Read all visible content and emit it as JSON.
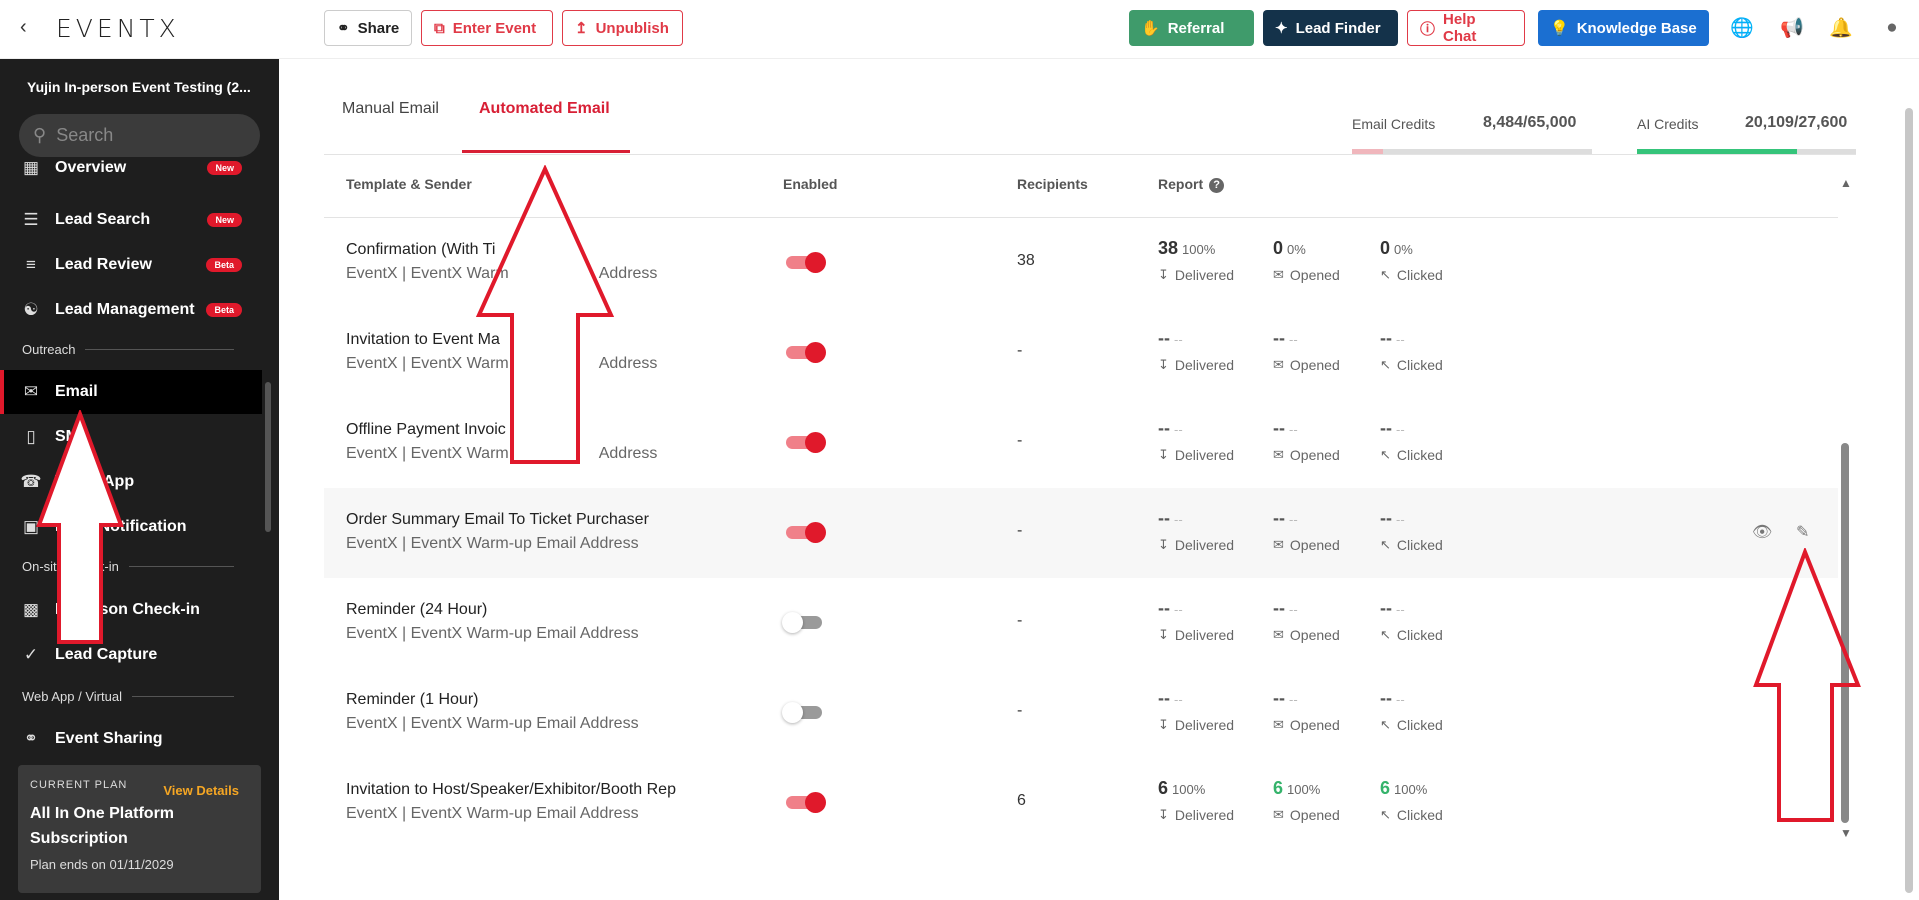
{
  "topbar": {
    "logo": "EVENTX",
    "share_label": "Share",
    "enter_label": "Enter Event",
    "unpublish_label": "Unpublish",
    "referral_label": "Referral",
    "lead_finder_label": "Lead Finder",
    "help_chat_label": "Help Chat",
    "knowledge_base_label": "Knowledge Base"
  },
  "sidebar": {
    "event_name": "Yujin In-person Event Testing (2...",
    "search_placeholder": "Search",
    "items": [
      {
        "label": "Overview",
        "badge": "New"
      },
      {
        "label": "Lead Search",
        "badge": "New"
      },
      {
        "label": "Lead Review",
        "badge": "Beta"
      },
      {
        "label": "Lead Management",
        "badge": "Beta"
      },
      {
        "label": "Email"
      },
      {
        "label": "SMS"
      },
      {
        "label": "WhatsApp"
      },
      {
        "label": "Push Notification"
      },
      {
        "label": "In-person Check-in"
      },
      {
        "label": "Lead Capture"
      },
      {
        "label": "Event Sharing"
      }
    ],
    "sections": [
      "Outreach",
      "On-site Check-in",
      "Web App / Virtual"
    ],
    "plan": {
      "current_label": "CURRENT PLAN",
      "view_details": "View Details",
      "name": "All In One Platform Subscription",
      "ends": "Plan ends on 01/11/2029"
    }
  },
  "main": {
    "tabs": [
      "Manual Email",
      "Automated Email"
    ],
    "email_credits_label": "Email Credits",
    "email_credits_value": "8,484/65,000",
    "email_credits_fill": 0.13,
    "ai_credits_label": "AI Credits",
    "ai_credits_value": "20,109/27,600",
    "ai_credits_fill": 0.73,
    "columns": [
      "Template & Sender",
      "Enabled",
      "Recipients",
      "Report"
    ],
    "stat_labels": [
      "Delivered",
      "Opened",
      "Clicked"
    ],
    "rows": [
      {
        "name": "Confirmation (With Ti",
        "sender": "EventX | EventX Warm",
        "sender_tail": "Address",
        "enabled": true,
        "recipients": "38",
        "stats": [
          {
            "v": "38",
            "p": "100%"
          },
          {
            "v": "0",
            "p": "0%"
          },
          {
            "v": "0",
            "p": "0%"
          }
        ]
      },
      {
        "name": "Invitation to Event Ma",
        "sender": "EventX | EventX Warm",
        "sender_tail": "Address",
        "enabled": true,
        "recipients": "-",
        "stats": [
          {
            "v": "--",
            "p": "--"
          },
          {
            "v": "--",
            "p": "--"
          },
          {
            "v": "--",
            "p": "--"
          }
        ]
      },
      {
        "name": "Offline Payment Invoic",
        "sender": "EventX | EventX Warm",
        "sender_tail": "Address",
        "enabled": true,
        "recipients": "-",
        "stats": [
          {
            "v": "--",
            "p": "--"
          },
          {
            "v": "--",
            "p": "--"
          },
          {
            "v": "--",
            "p": "--"
          }
        ]
      },
      {
        "name": "Order Summary Email To Ticket Purchaser",
        "sender": "EventX | EventX Warm-up Email Address",
        "sender_tail": "",
        "enabled": true,
        "recipients": "-",
        "stats": [
          {
            "v": "--",
            "p": "--"
          },
          {
            "v": "--",
            "p": "--"
          },
          {
            "v": "--",
            "p": "--"
          }
        ]
      },
      {
        "name": "Reminder (24 Hour)",
        "sender": "EventX | EventX Warm-up Email Address",
        "sender_tail": "",
        "enabled": false,
        "recipients": "-",
        "stats": [
          {
            "v": "--",
            "p": "--"
          },
          {
            "v": "--",
            "p": "--"
          },
          {
            "v": "--",
            "p": "--"
          }
        ]
      },
      {
        "name": "Reminder (1 Hour)",
        "sender": "EventX | EventX Warm-up Email Address",
        "sender_tail": "",
        "enabled": false,
        "recipients": "-",
        "stats": [
          {
            "v": "--",
            "p": "--"
          },
          {
            "v": "--",
            "p": "--"
          },
          {
            "v": "--",
            "p": "--"
          }
        ]
      },
      {
        "name": "Invitation to Host/Speaker/Exhibitor/Booth Rep",
        "sender": "EventX | EventX Warm-up Email Address",
        "sender_tail": "",
        "enabled": true,
        "recipients": "6",
        "stats": [
          {
            "v": "6",
            "p": "100%"
          },
          {
            "v": "6",
            "p": "100%"
          },
          {
            "v": "6",
            "p": "100%"
          }
        ]
      }
    ]
  }
}
